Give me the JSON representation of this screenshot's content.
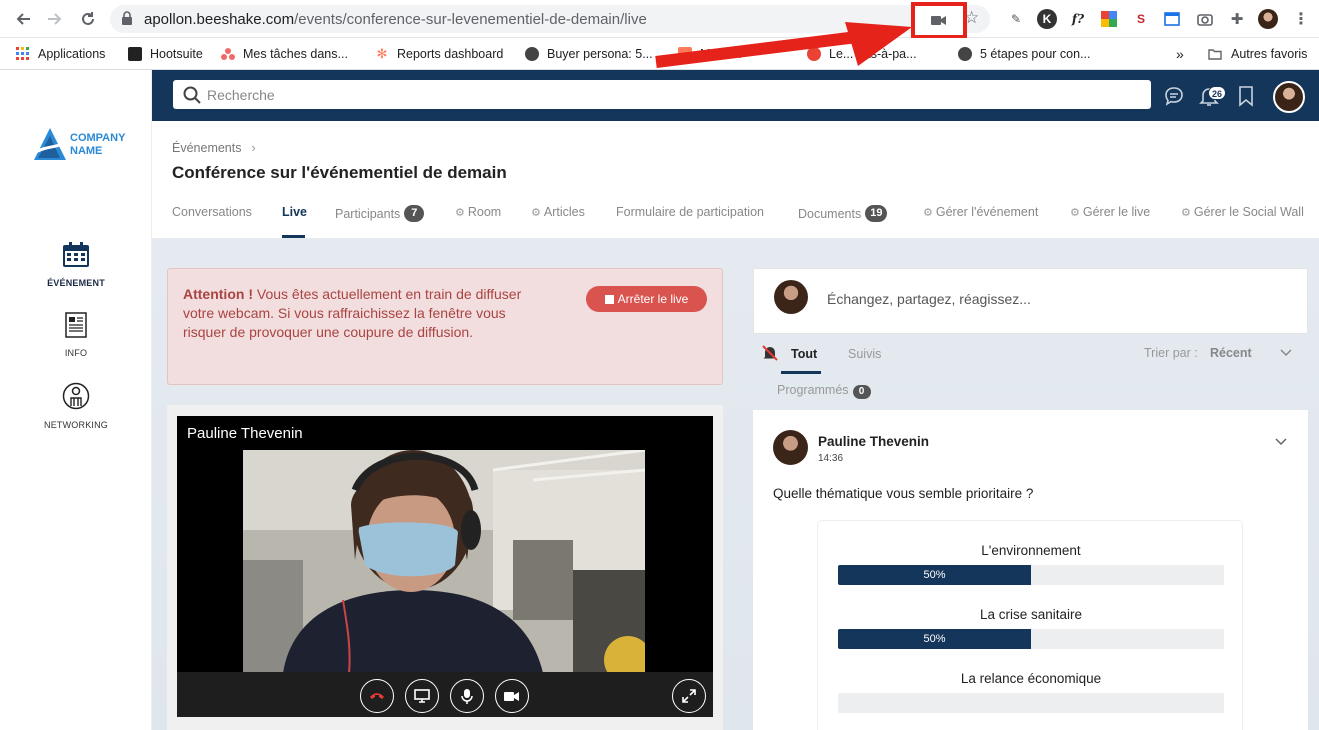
{
  "browser": {
    "url_host": "apollon.beeshake.com",
    "url_path": "/events/conference-sur-levenementiel-de-demain/live",
    "bookmarks": [
      {
        "label": "Applications",
        "icon": "apps-grid-icon"
      },
      {
        "label": "Hootsuite",
        "icon": "hootsuite-icon"
      },
      {
        "label": "Mes tâches dans...",
        "icon": "asana-icon"
      },
      {
        "label": "Reports dashboard",
        "icon": "hubspot-icon"
      },
      {
        "label": "Buyer persona: 5...",
        "icon": "globe-icon"
      },
      {
        "label": "Morai...",
        "icon": "hubspot-icon"
      },
      {
        "label": "Le... pas-à-pa...",
        "icon": "globe-icon"
      },
      {
        "label": "5 étapes pour con...",
        "icon": "globe-icon"
      }
    ],
    "overflow": "»",
    "other_bookmarks": "Autres favoris",
    "camera_indicator_color": "#e5231b"
  },
  "app": {
    "logo_line1": "COMPANY",
    "logo_line2": "NAME",
    "sidebar": [
      {
        "label": "ÉVÉNEMENT",
        "icon": "calendar-icon",
        "active": true
      },
      {
        "label": "INFO",
        "icon": "document-icon",
        "active": false
      },
      {
        "label": "NETWORKING",
        "icon": "person-icon",
        "active": false
      }
    ],
    "search_placeholder": "Recherche",
    "notifications_count": "26",
    "brand_color": "#14365a"
  },
  "event": {
    "breadcrumb": "Événements",
    "title": "Conférence sur l'événementiel de demain",
    "tabs": [
      {
        "label": "Conversations"
      },
      {
        "label": "Live",
        "active": true
      },
      {
        "label": "Participants",
        "count": "7"
      },
      {
        "label": "Room",
        "gear": true
      },
      {
        "label": "Articles",
        "gear": true
      },
      {
        "label": "Formulaire de participation"
      },
      {
        "label": "Documents",
        "count": "19"
      },
      {
        "label": "Gérer l'événement",
        "gear": true
      },
      {
        "label": "Gérer le live",
        "gear": true
      },
      {
        "label": "Gérer le Social Wall",
        "gear": true
      }
    ]
  },
  "alert": {
    "strong": "Attention !",
    "text": " Vous êtes actuellement en train de diffuser votre webcam. Si vous raffraichissez la fenêtre vous risquer de provoquer une coupure de diffusion.",
    "button": "Arrêter le live"
  },
  "video": {
    "speaker_name": "Pauline Thevenin",
    "controls": [
      "hangup-icon",
      "screen-share-icon",
      "microphone-icon",
      "camera-icon"
    ],
    "fullscreen_icon": "fullscreen-icon"
  },
  "feed": {
    "compose_placeholder": "Échangez, partagez, réagissez...",
    "filters": {
      "all": "Tout",
      "followed": "Suivis",
      "scheduled": "Programmés",
      "scheduled_count": "0",
      "sort_label": "Trier par :",
      "sort_value": "Récent"
    },
    "post": {
      "author": "Pauline Thevenin",
      "time": "14:36",
      "question": "Quelle thématique vous semble prioritaire ?",
      "poll": [
        {
          "label": "L'environnement",
          "percent": 50,
          "text": "50%"
        },
        {
          "label": "La crise sanitaire",
          "percent": 50,
          "text": "50%"
        },
        {
          "label": "La relance économique",
          "percent": 0,
          "text": "0%"
        }
      ]
    }
  }
}
